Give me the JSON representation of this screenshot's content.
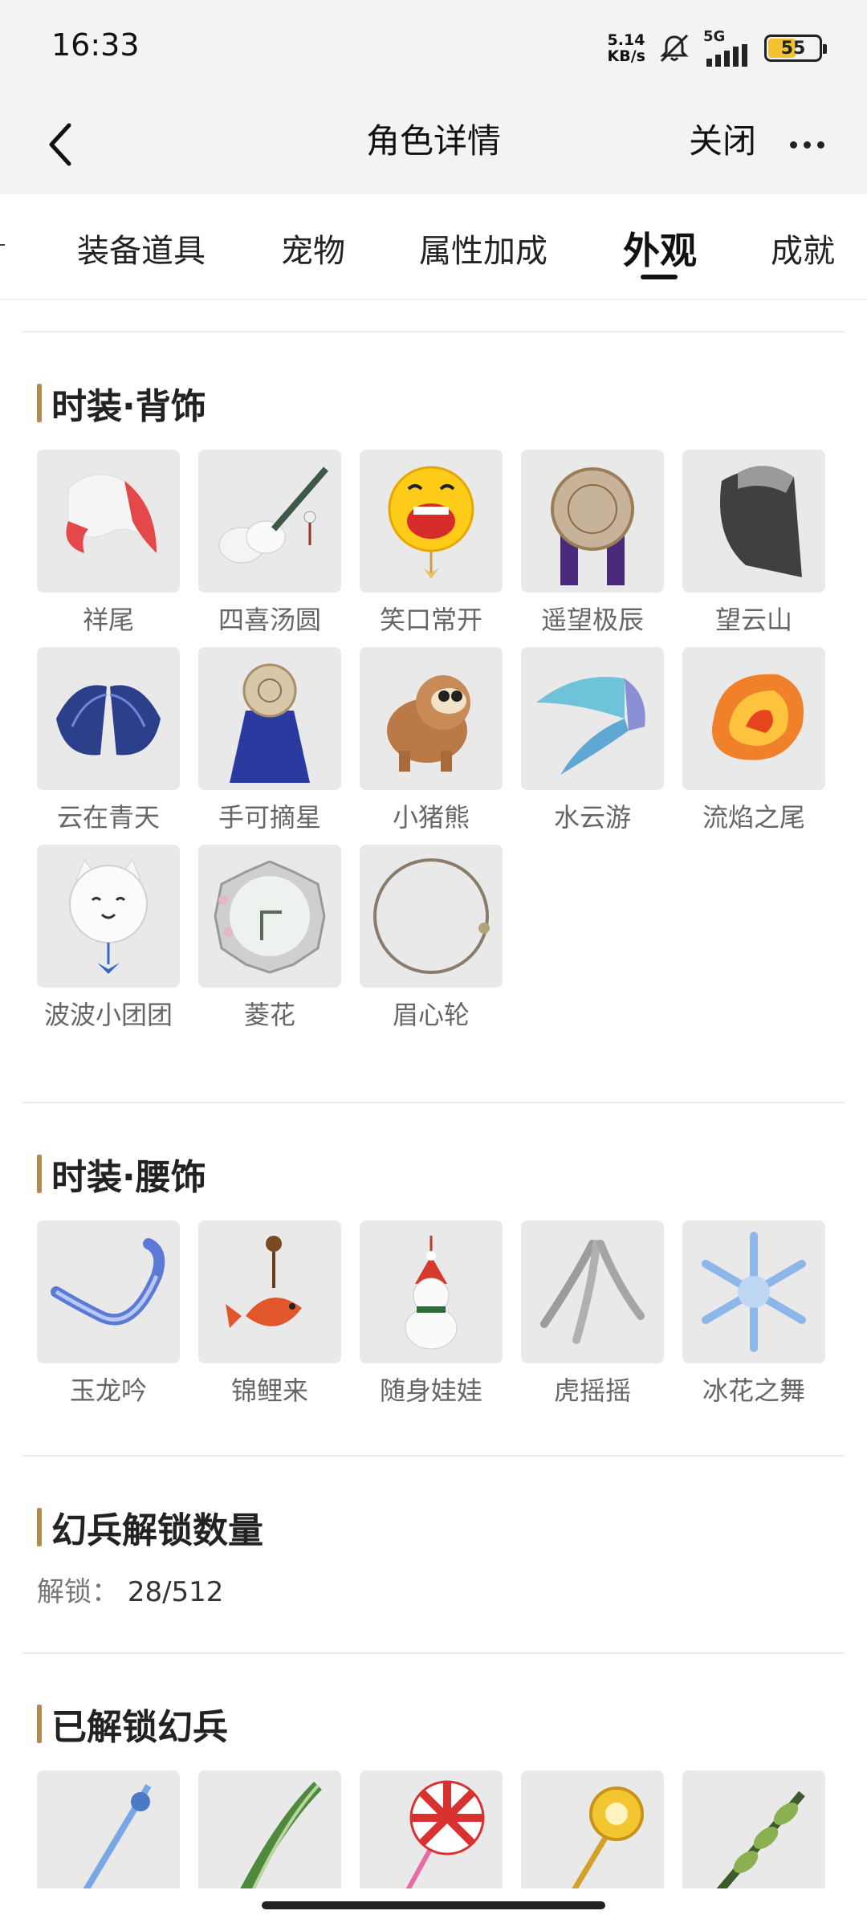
{
  "status": {
    "time": "16:33",
    "net_speed_top": "5.14",
    "net_speed_bottom": "KB/s",
    "network": "5G",
    "battery": "55",
    "battery_level": 0.55
  },
  "nav": {
    "title": "角色详情",
    "close": "关闭"
  },
  "tabs": [
    {
      "label": "装备道具"
    },
    {
      "label": "宠物"
    },
    {
      "label": "属性加成"
    },
    {
      "label": "外观"
    },
    {
      "label": "成就"
    }
  ],
  "sections": {
    "back": {
      "title": "时装·背饰",
      "items": [
        {
          "name": "祥尾",
          "icon": "fox-tail-icon"
        },
        {
          "name": "四喜汤圆",
          "icon": "dumpling-pipa-icon"
        },
        {
          "name": "笑口常开",
          "icon": "smile-balloon-icon"
        },
        {
          "name": "遥望极辰",
          "icon": "star-disc-icon"
        },
        {
          "name": "望云山",
          "icon": "mountain-cape-icon"
        },
        {
          "name": "云在青天",
          "icon": "blue-wings-icon"
        },
        {
          "name": "手可摘星",
          "icon": "star-cape-icon"
        },
        {
          "name": "小猪熊",
          "icon": "pig-bear-icon"
        },
        {
          "name": "水云游",
          "icon": "fin-wings-icon"
        },
        {
          "name": "流焰之尾",
          "icon": "flame-tail-icon"
        },
        {
          "name": "波波小团团",
          "icon": "cat-balloon-icon"
        },
        {
          "name": "菱花",
          "icon": "mirror-icon"
        },
        {
          "name": "眉心轮",
          "icon": "ring-icon"
        }
      ]
    },
    "waist": {
      "title": "时装·腰饰",
      "items": [
        {
          "name": "玉龙吟",
          "icon": "jade-dragon-icon"
        },
        {
          "name": "锦鲤来",
          "icon": "koi-pendant-icon"
        },
        {
          "name": "随身娃娃",
          "icon": "snowman-icon"
        },
        {
          "name": "虎摇摇",
          "icon": "tiger-tail-icon"
        },
        {
          "name": "冰花之舞",
          "icon": "snowflake-icon"
        }
      ]
    },
    "unlock_count": {
      "title": "幻兵解锁数量",
      "label": "解锁：",
      "value": "28/512"
    },
    "unlocked": {
      "title": "已解锁幻兵",
      "items": [
        {
          "icon": "blue-staff-icon"
        },
        {
          "icon": "green-leek-icon"
        },
        {
          "icon": "lollipop-icon"
        },
        {
          "icon": "golden-staff-icon"
        },
        {
          "icon": "vine-sword-icon"
        }
      ]
    }
  }
}
